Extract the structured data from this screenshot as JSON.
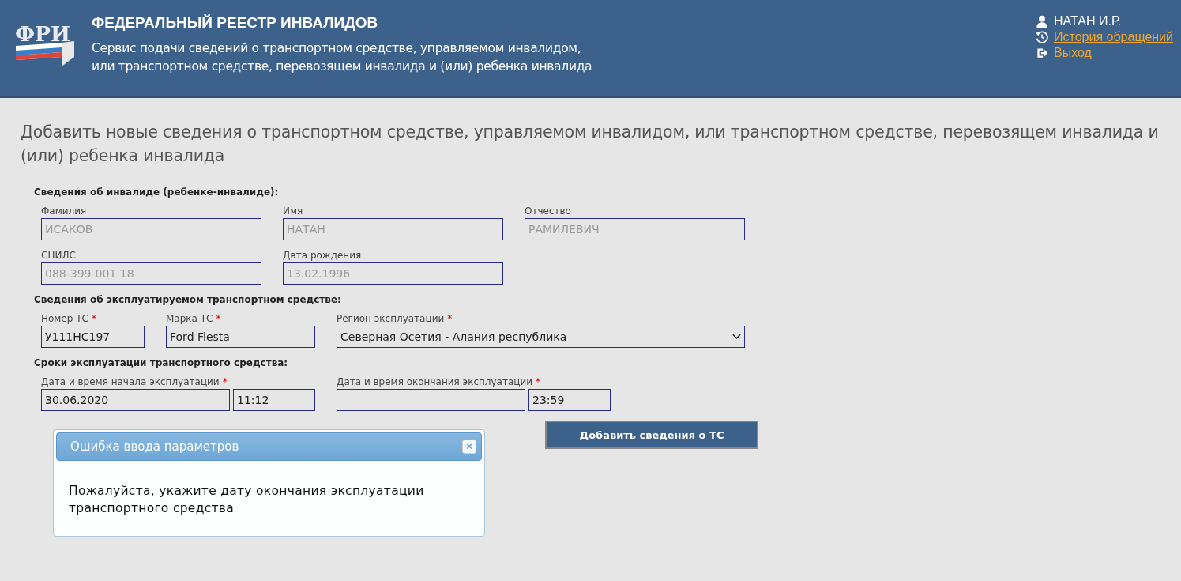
{
  "header": {
    "logo_text": "ФРИ",
    "title": "ФЕДЕРАЛЬНЫЙ РЕЕСТР ИНВАЛИДОВ",
    "subtitle_lines": [
      "Сервис подачи сведений о транспортном средстве, управляемом инвалидом,",
      "или транспортном средстве, перевозящем инвалида и (или) ребенка инвалида"
    ],
    "user": "НАТАН И.Р.",
    "links": [
      {
        "kind": "history",
        "label": "История обращений"
      },
      {
        "kind": "logout",
        "label": "Выход"
      }
    ]
  },
  "page_title": "Добавить новые сведения о транспортном средстве, управляемом инвалидом, или транспортном средстве, перевозящем инвалида и (или) ребенка инвалида",
  "sections": [
    {
      "title": "Сведения об инвалиде (ребенке-инвалиде):",
      "rows": [
        [
          {
            "kind": "text",
            "label": "Фамилия",
            "disabled": true,
            "value": "ИСАКОВ"
          },
          {
            "kind": "text",
            "label": "Имя",
            "disabled": true,
            "value": "НАТАН"
          },
          {
            "kind": "text",
            "label": "Отчество",
            "disabled": true,
            "value": "РАМИЛЕВИЧ"
          }
        ],
        [
          {
            "kind": "text",
            "label": "СНИЛС",
            "disabled": true,
            "value": "088-399-001 18"
          },
          {
            "kind": "text",
            "label": "Дата рождения",
            "disabled": true,
            "value": "13.02.1996"
          }
        ]
      ]
    },
    {
      "title": "Сведения об эксплуатируемом транспортном средстве:",
      "rows": [
        [
          {
            "kind": "short",
            "label": "Номер ТС",
            "required_mark": "*",
            "disabled": false,
            "value": "У111НС197"
          },
          {
            "kind": "medium",
            "label": "Марка ТС",
            "required_mark": "*",
            "disabled": false,
            "value": "Ford Fiesta"
          },
          {
            "kind": "select",
            "label": "Регион эксплуатации",
            "required_mark": "*",
            "disabled": false,
            "value": "Северная Осетия - Алания республика"
          }
        ]
      ]
    },
    {
      "title": "Сроки эксплуатации транспортного средства:",
      "rows": [
        [
          {
            "kind": "datetime",
            "label": "Дата и время начала эксплуатации",
            "required_mark": "*",
            "disabled": false,
            "date": "30.06.2020",
            "time": "11:12"
          },
          {
            "kind": "datetime",
            "label": "Дата и время окончания эксплуатации",
            "required_mark": "*",
            "disabled": false,
            "time": "23:59"
          }
        ]
      ]
    }
  ],
  "submit_button": "Добавить сведения о ТС",
  "dialog": {
    "title": "Ошибка ввода параметров",
    "close": "×",
    "message": "Пожалуйста, укажите дату окончания эксплуатации транспортного средства"
  }
}
